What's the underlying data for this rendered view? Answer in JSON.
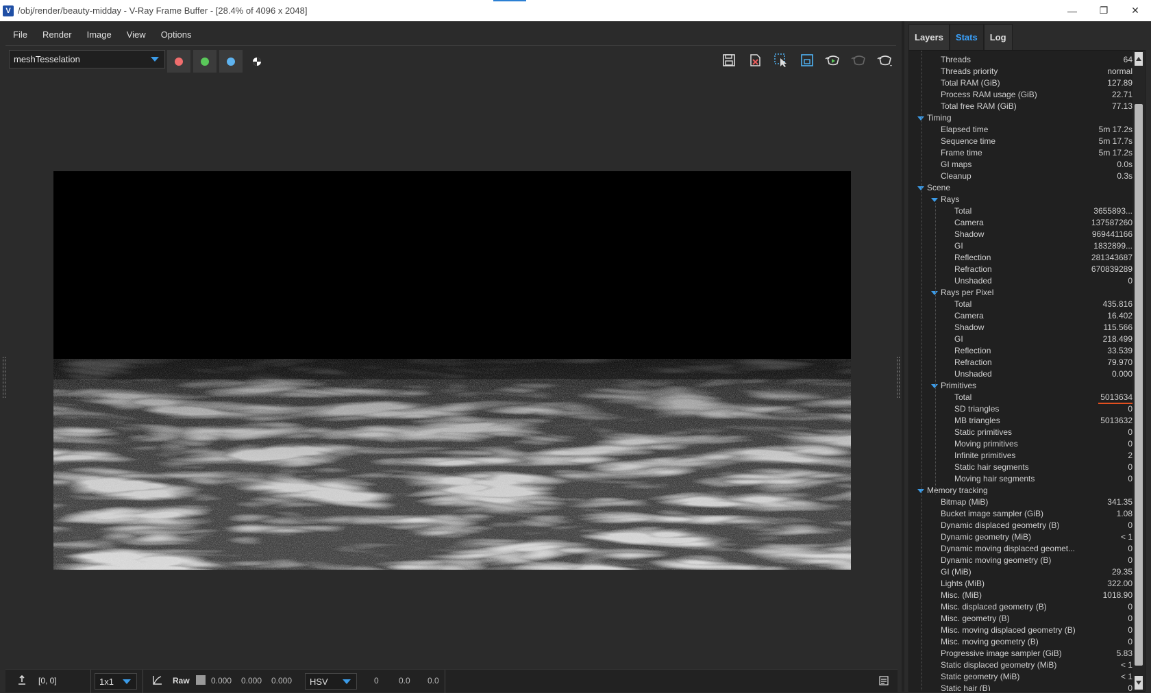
{
  "window": {
    "title": "/obj/render/beauty-midday - V-Ray Frame Buffer - [28.4% of 4096 x 2048]",
    "app_icon": "V"
  },
  "menu": [
    "File",
    "Render",
    "Image",
    "View",
    "Options"
  ],
  "toolbar": {
    "channel": "meshTesselation",
    "channel_buttons": [
      {
        "name": "red-channel",
        "color": "#f06d6d"
      },
      {
        "name": "green-channel",
        "color": "#5ac85a"
      },
      {
        "name": "blue-channel",
        "color": "#5eb3ef"
      }
    ],
    "icons": [
      "save-icon",
      "clear-image-icon",
      "region-select-icon",
      "track-mouse-icon",
      "render-icon",
      "stop-render-icon",
      "render-options-icon"
    ]
  },
  "status": {
    "coords": "[0, 0]",
    "zoom": "1x1",
    "raw_label": "Raw",
    "raw_values": [
      "0.000",
      "0.000",
      "0.000"
    ],
    "color_mode": "HSV",
    "color_values": [
      "0",
      "0.0",
      "0.0"
    ]
  },
  "panel": {
    "tabs": [
      "Layers",
      "Stats",
      "Log"
    ],
    "active_tab": "Stats"
  },
  "stats": [
    {
      "level": 1,
      "label": "Threads",
      "value": "64"
    },
    {
      "level": 1,
      "label": "Threads priority",
      "value": "normal"
    },
    {
      "level": 1,
      "label": "Total RAM (GiB)",
      "value": "127.89"
    },
    {
      "level": 1,
      "label": "Process RAM usage (GiB)",
      "value": "22.71"
    },
    {
      "level": 1,
      "label": "Total free RAM (GiB)",
      "value": "77.13"
    },
    {
      "level": 0,
      "label": "Timing",
      "value": "",
      "group": true
    },
    {
      "level": 1,
      "label": "Elapsed time",
      "value": "5m 17.2s"
    },
    {
      "level": 1,
      "label": "Sequence time",
      "value": "5m 17.7s"
    },
    {
      "level": 1,
      "label": "Frame time",
      "value": "5m 17.2s"
    },
    {
      "level": 1,
      "label": "GI maps",
      "value": "0.0s"
    },
    {
      "level": 1,
      "label": "Cleanup",
      "value": "0.3s"
    },
    {
      "level": 0,
      "label": "Scene",
      "value": "",
      "group": true
    },
    {
      "level": 1,
      "label": "Rays",
      "value": "",
      "group": true
    },
    {
      "level": 2,
      "label": "Total",
      "value": "3655893..."
    },
    {
      "level": 2,
      "label": "Camera",
      "value": "137587260"
    },
    {
      "level": 2,
      "label": "Shadow",
      "value": "969441166"
    },
    {
      "level": 2,
      "label": "GI",
      "value": "1832899..."
    },
    {
      "level": 2,
      "label": "Reflection",
      "value": "281343687"
    },
    {
      "level": 2,
      "label": "Refraction",
      "value": "670839289"
    },
    {
      "level": 2,
      "label": "Unshaded",
      "value": "0"
    },
    {
      "level": 1,
      "label": "Rays per Pixel",
      "value": "",
      "group": true
    },
    {
      "level": 2,
      "label": "Total",
      "value": "435.816"
    },
    {
      "level": 2,
      "label": "Camera",
      "value": "16.402"
    },
    {
      "level": 2,
      "label": "Shadow",
      "value": "115.566"
    },
    {
      "level": 2,
      "label": "GI",
      "value": "218.499"
    },
    {
      "level": 2,
      "label": "Reflection",
      "value": "33.539"
    },
    {
      "level": 2,
      "label": "Refraction",
      "value": "79.970"
    },
    {
      "level": 2,
      "label": "Unshaded",
      "value": "0.000"
    },
    {
      "level": 1,
      "label": "Primitives",
      "value": "",
      "group": true
    },
    {
      "level": 2,
      "label": "Total",
      "value": "5013634",
      "highlight": true
    },
    {
      "level": 2,
      "label": "SD triangles",
      "value": "0"
    },
    {
      "level": 2,
      "label": "MB triangles",
      "value": "5013632"
    },
    {
      "level": 2,
      "label": "Static primitives",
      "value": "0"
    },
    {
      "level": 2,
      "label": "Moving primitives",
      "value": "0"
    },
    {
      "level": 2,
      "label": "Infinite primitives",
      "value": "2"
    },
    {
      "level": 2,
      "label": "Static hair segments",
      "value": "0"
    },
    {
      "level": 2,
      "label": "Moving hair segments",
      "value": "0"
    },
    {
      "level": 0,
      "label": "Memory tracking",
      "value": "",
      "group": true
    },
    {
      "level": 1,
      "label": "Bitmap (MiB)",
      "value": "341.35"
    },
    {
      "level": 1,
      "label": "Bucket image sampler (GiB)",
      "value": "1.08"
    },
    {
      "level": 1,
      "label": "Dynamic displaced geometry (B)",
      "value": "0"
    },
    {
      "level": 1,
      "label": "Dynamic geometry (MiB)",
      "value": "< 1"
    },
    {
      "level": 1,
      "label": "Dynamic moving displaced geomet...",
      "value": "0"
    },
    {
      "level": 1,
      "label": "Dynamic moving geometry (B)",
      "value": "0"
    },
    {
      "level": 1,
      "label": "GI (MiB)",
      "value": "29.35"
    },
    {
      "level": 1,
      "label": "Lights (MiB)",
      "value": "322.00"
    },
    {
      "level": 1,
      "label": "Misc. (MiB)",
      "value": "1018.90"
    },
    {
      "level": 1,
      "label": "Misc. displaced geometry (B)",
      "value": "0"
    },
    {
      "level": 1,
      "label": "Misc. geometry (B)",
      "value": "0"
    },
    {
      "level": 1,
      "label": "Misc. moving displaced geometry (B)",
      "value": "0"
    },
    {
      "level": 1,
      "label": "Misc. moving geometry (B)",
      "value": "0"
    },
    {
      "level": 1,
      "label": "Progressive image sampler (GiB)",
      "value": "5.83"
    },
    {
      "level": 1,
      "label": "Static displaced geometry (MiB)",
      "value": "< 1"
    },
    {
      "level": 1,
      "label": "Static geometry (MiB)",
      "value": "< 1"
    },
    {
      "level": 1,
      "label": "Static hair (B)",
      "value": "0"
    }
  ],
  "colors": {
    "accent": "#3b9be8",
    "highlight_underline": "#e3501f"
  }
}
